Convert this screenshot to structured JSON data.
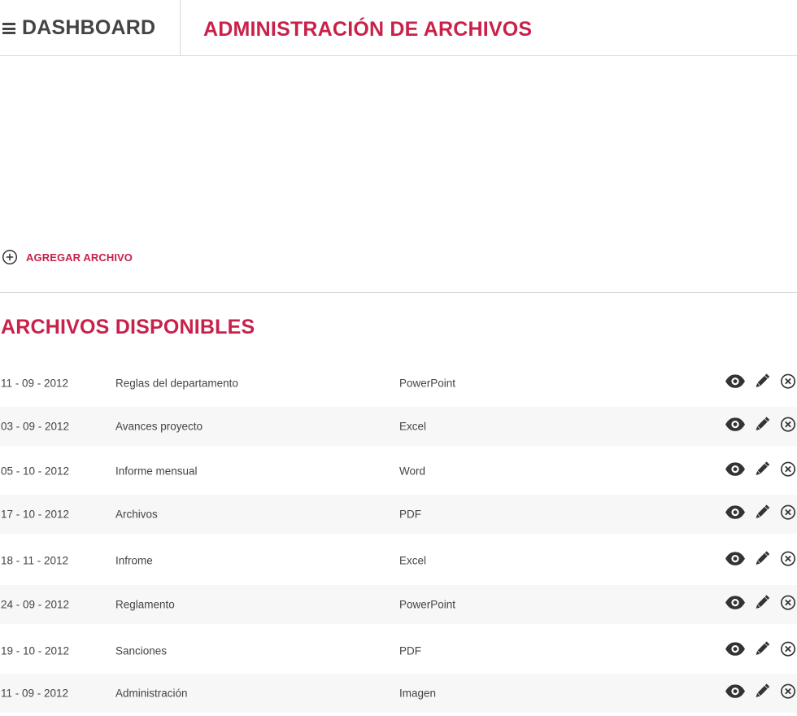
{
  "header": {
    "dashboard_label": "DASHBOARD",
    "page_title": "ADMINISTRACIÓN DE ARCHIVOS"
  },
  "add_file": {
    "label": "AGREGAR ARCHIVO",
    "icon": "plus-circle-icon"
  },
  "files_section": {
    "title": "ARCHIVOS DISPONIBLES",
    "rows": [
      {
        "date": "11 - 09 - 2012",
        "name": "Reglas del departamento",
        "type": "PowerPoint"
      },
      {
        "date": "03 - 09 - 2012",
        "name": "Avances proyecto",
        "type": "Excel"
      },
      {
        "date": "05 - 10 - 2012",
        "name": "Informe mensual",
        "type": "Word"
      },
      {
        "date": "17 - 10 - 2012",
        "name": "Archivos",
        "type": "PDF"
      },
      {
        "date": "18 - 11 - 2012",
        "name": "Infrome",
        "type": "Excel"
      },
      {
        "date": "24 - 09 - 2012",
        "name": "Reglamento",
        "type": "PowerPoint"
      },
      {
        "date": "19 - 10 - 2012",
        "name": "Sanciones",
        "type": "PDF"
      },
      {
        "date": "11 - 09 - 2012",
        "name": "Administración",
        "type": "Imagen"
      }
    ],
    "row_actions": [
      "eye-icon",
      "pencil-icon",
      "close-circle-icon"
    ]
  },
  "colors": {
    "accent": "#c8214a",
    "text": "#444444",
    "divider": "#d9d9d9",
    "row_alt": "#f7f7f7"
  }
}
